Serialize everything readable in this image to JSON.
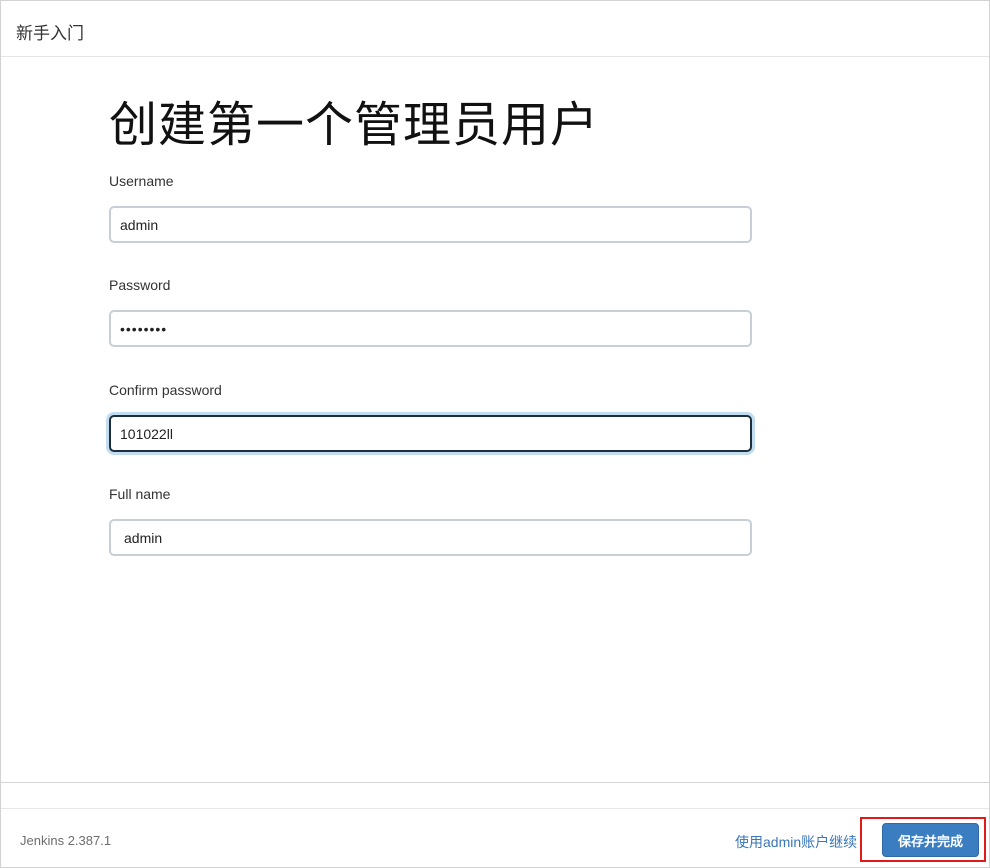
{
  "header": {
    "title": "新手入门"
  },
  "main": {
    "title": "创建第一个管理员用户",
    "fields": [
      {
        "label": "Username",
        "value": "admin"
      },
      {
        "label": "Password",
        "value": "••••••••"
      },
      {
        "label": "Confirm password",
        "value": "101022ll"
      },
      {
        "label": "Full name",
        "value": "admin"
      }
    ]
  },
  "footer": {
    "version": "Jenkins 2.387.1",
    "skip_link": "使用admin账户继续",
    "save_button": "保存并完成"
  },
  "colors": {
    "primary_button": "#3a7dc1",
    "link": "#3a76b8",
    "highlight_border": "#e0191b",
    "focus_ring": "#c3ddf0"
  }
}
